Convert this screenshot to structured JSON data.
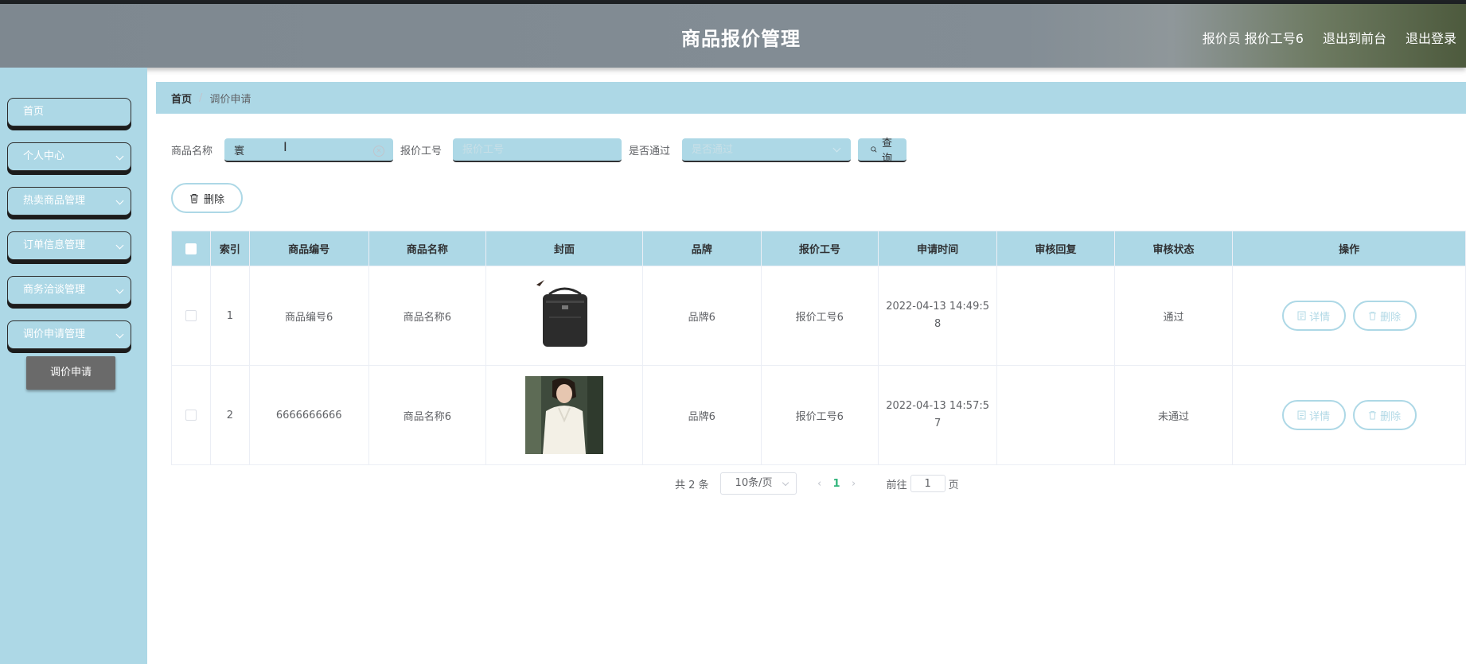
{
  "header": {
    "title": "商品报价管理",
    "user_label": "报价员 报价工号6",
    "to_frontend": "退出到前台",
    "logout": "退出登录"
  },
  "sidebar": {
    "items": [
      {
        "label": "首页"
      },
      {
        "label": "个人中心"
      },
      {
        "label": "热卖商品管理"
      },
      {
        "label": "订单信息管理"
      },
      {
        "label": "商务洽谈管理"
      },
      {
        "label": "调价申请管理"
      }
    ],
    "active_sub": "调价申请"
  },
  "breadcrumb": {
    "home": "首页",
    "separator": "/",
    "current": "调价申请"
  },
  "search": {
    "product_name_label": "商品名称",
    "product_name_value": "寰",
    "quote_no_label": "报价工号",
    "quote_no_placeholder": "报价工号",
    "pass_label": "是否通过",
    "pass_placeholder": "是否通过",
    "query_label": "查询"
  },
  "actions": {
    "delete_label": "删除"
  },
  "table": {
    "columns": [
      "索引",
      "商品编号",
      "商品名称",
      "封面",
      "品牌",
      "报价工号",
      "申请时间",
      "审核回复",
      "审核状态",
      "操作"
    ],
    "rows": [
      {
        "index": "1",
        "product_no": "商品编号6",
        "product_name": "商品名称6",
        "cover": "black-shoulder-bag",
        "brand": "品牌6",
        "quote_no": "报价工号6",
        "apply_time": "2022-04-13 14:49:58",
        "reply": "",
        "status": "通过"
      },
      {
        "index": "2",
        "product_no": "6666666666",
        "product_name": "商品名称6",
        "cover": "white-blouse-model",
        "brand": "品牌6",
        "quote_no": "报价工号6",
        "apply_time": "2022-04-13 14:57:57",
        "reply": "",
        "status": "未通过"
      }
    ],
    "detail_label": "详情",
    "delete_label": "删除"
  },
  "pagination": {
    "total_text": "共 2 条",
    "page_size": "10条/页",
    "current_page": "1",
    "goto_prefix": "前往",
    "goto_value": "1",
    "goto_suffix": "页"
  },
  "colors": {
    "accent": "#add8e6",
    "active_sub_bg": "#6a6a6a",
    "header_bg": "#838d95"
  }
}
